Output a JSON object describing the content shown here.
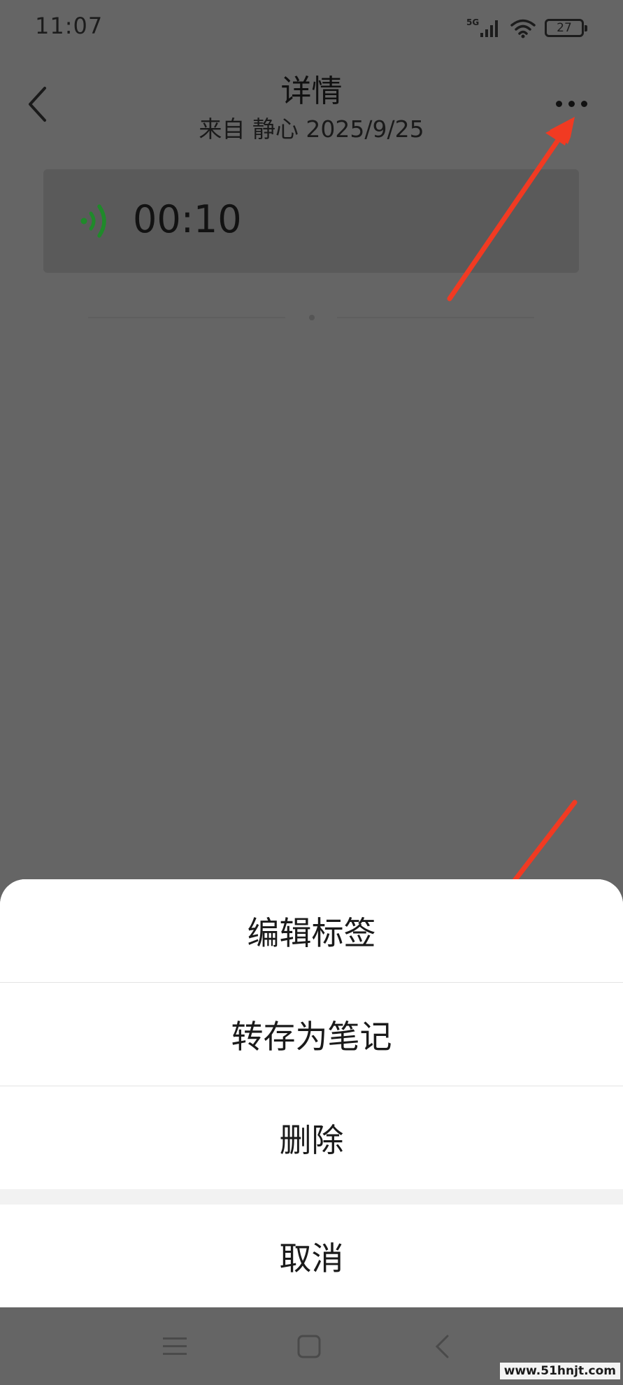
{
  "status_bar": {
    "time": "11:07",
    "network": "5G",
    "battery": "27",
    "icons": [
      "signal-icon",
      "wifi-icon",
      "battery-icon"
    ]
  },
  "header": {
    "title": "详情",
    "subtitle": "来自 静心 2025/9/25",
    "back_icon": "chevron-left-icon",
    "more_icon": "more-horizontal-icon"
  },
  "voice_message": {
    "duration": "00:10",
    "icon": "voice-wave-icon",
    "icon_color": "#1f8a2a"
  },
  "action_sheet": {
    "items": [
      {
        "label": "编辑标签"
      },
      {
        "label": "转存为笔记"
      },
      {
        "label": "删除"
      }
    ],
    "cancel_label": "取消"
  },
  "annotation": {
    "arrow_color": "#f13a22"
  },
  "nav_bar": {
    "icons": [
      "menu-icon",
      "home-icon",
      "back-icon"
    ]
  },
  "watermark": "www.51hnjt.com"
}
